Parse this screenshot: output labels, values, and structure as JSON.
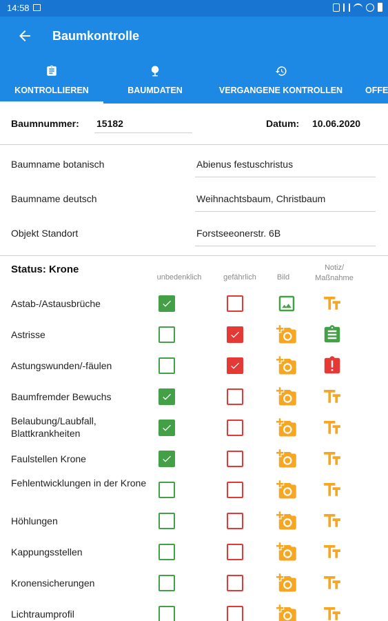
{
  "statusbar": {
    "time": "14:58"
  },
  "appbar": {
    "title": "Baumkontrolle",
    "back_icon": "arrow-back-icon"
  },
  "tabs": [
    {
      "label": "KONTROLLIEREN",
      "icon": "clipboard-icon",
      "active": true
    },
    {
      "label": "BAUMDATEN",
      "icon": "tree-icon",
      "active": false
    },
    {
      "label": "VERGANGENE KONTROLLEN",
      "icon": "history-icon",
      "active": false
    },
    {
      "label": "OFFE",
      "icon": "",
      "active": false
    }
  ],
  "header": {
    "baumnummer_label": "Baumnummer:",
    "baumnummer_value": "15182",
    "datum_label": "Datum:",
    "datum_value": "10.06.2020"
  },
  "fields": [
    {
      "label": "Baumname botanisch",
      "value": "Abienus festuschristus"
    },
    {
      "label": "Baumname deutsch",
      "value": "Weihnachtsbaum, Christbaum"
    },
    {
      "label": "Objekt Standort",
      "value": "Forstseeonerstr. 6B"
    }
  ],
  "section": {
    "title": "Status: Krone",
    "col_unbedenklich": "unbedenklich",
    "col_gefaehrlich": "gefährlich",
    "col_bild": "Bild",
    "col_notiz": "Notiz/\nMaßnahme"
  },
  "colors": {
    "primary": "#1e88e5",
    "statusbar": "#1876d2",
    "green": "#43a047",
    "red": "#e53935",
    "orange": "#f5a623"
  },
  "rows": [
    {
      "label": "Astab-/Astausbrüche",
      "unbedenklich": true,
      "gefaehrlich": false,
      "bild": "image-icon",
      "notiz": "text-format-icon"
    },
    {
      "label": "Astrisse",
      "unbedenklich": false,
      "gefaehrlich": true,
      "bild": "add-photo-icon",
      "notiz": "note-icon"
    },
    {
      "label": "Astungswunden/-fäulen",
      "unbedenklich": false,
      "gefaehrlich": true,
      "bild": "add-photo-icon",
      "notiz": "alert-icon"
    },
    {
      "label": "Baumfremder Bewuchs",
      "unbedenklich": true,
      "gefaehrlich": false,
      "bild": "add-photo-icon",
      "notiz": "text-format-icon"
    },
    {
      "label": "Belaubung/Laubfall, Blattkrankheiten",
      "unbedenklich": true,
      "gefaehrlich": false,
      "bild": "add-photo-icon",
      "notiz": "text-format-icon"
    },
    {
      "label": "Faulstellen Krone",
      "unbedenklich": true,
      "gefaehrlich": false,
      "bild": "add-photo-icon",
      "notiz": "text-format-icon"
    },
    {
      "label": "Fehlentwicklungen in der Krone",
      "unbedenklich": false,
      "gefaehrlich": false,
      "bild": "add-photo-icon",
      "notiz": "text-format-icon"
    },
    {
      "label": "Höhlungen",
      "unbedenklich": false,
      "gefaehrlich": false,
      "bild": "add-photo-icon",
      "notiz": "text-format-icon"
    },
    {
      "label": "Kappungsstellen",
      "unbedenklich": false,
      "gefaehrlich": false,
      "bild": "add-photo-icon",
      "notiz": "text-format-icon"
    },
    {
      "label": "Kronensicherungen",
      "unbedenklich": false,
      "gefaehrlich": false,
      "bild": "add-photo-icon",
      "notiz": "text-format-icon"
    },
    {
      "label": "Lichtraumprofil",
      "unbedenklich": false,
      "gefaehrlich": false,
      "bild": "add-photo-icon",
      "notiz": "text-format-icon"
    }
  ]
}
